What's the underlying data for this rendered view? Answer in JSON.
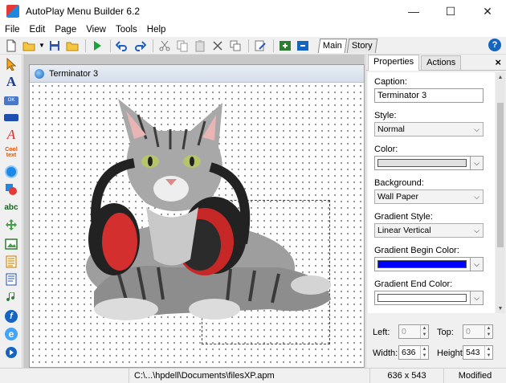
{
  "window": {
    "title": "AutoPlay Menu Builder 6.2"
  },
  "menu": [
    "File",
    "Edit",
    "Page",
    "View",
    "Tools",
    "Help"
  ],
  "toolbar": {
    "page_tabs": [
      "Main",
      "Story"
    ],
    "help_label": "?"
  },
  "left_tools": [
    "select-arrow-icon",
    "text-tool-icon",
    "button-tool-icon",
    "rectangle-tool-icon",
    "font-text-icon",
    "cool-text-icon",
    "hotspot-icon",
    "shapes-icon",
    "abc-text-icon",
    "move-icon",
    "image-tool-icon",
    "list-icon",
    "checklist-icon",
    "music-icon",
    "flash-icon",
    "ie-browser-icon",
    "media-play-icon"
  ],
  "left_tool_labels": {
    "button": "OK",
    "cool_text": "Cool text"
  },
  "page_window": {
    "title": "Terminator 3"
  },
  "right_panel": {
    "tabs": [
      "Properties",
      "Actions"
    ],
    "close": "×",
    "caption_label": "Caption:",
    "caption_value": "Terminator 3",
    "style_label": "Style:",
    "style_value": "Normal",
    "color_label": "Color:",
    "color_value": "#e0e0e0",
    "background_label": "Background:",
    "background_value": "Wall Paper",
    "gradient_style_label": "Gradient Style:",
    "gradient_style_value": "Linear Vertical",
    "gradient_begin_label": "Gradient Begin Color:",
    "gradient_begin_value": "#0000ff",
    "gradient_end_label": "Gradient End Color:",
    "gradient_end_value": "#ffffff"
  },
  "geometry": {
    "left_label": "Left:",
    "left_value": "0",
    "top_label": "Top:",
    "top_value": "0",
    "width_label": "Width:",
    "width_value": "636",
    "height_label": "Height:",
    "height_value": "543"
  },
  "status": {
    "path": "C:\\...\\hpdell\\Documents\\filesXP.apm",
    "size": "636 x 543",
    "state": "Modified"
  }
}
